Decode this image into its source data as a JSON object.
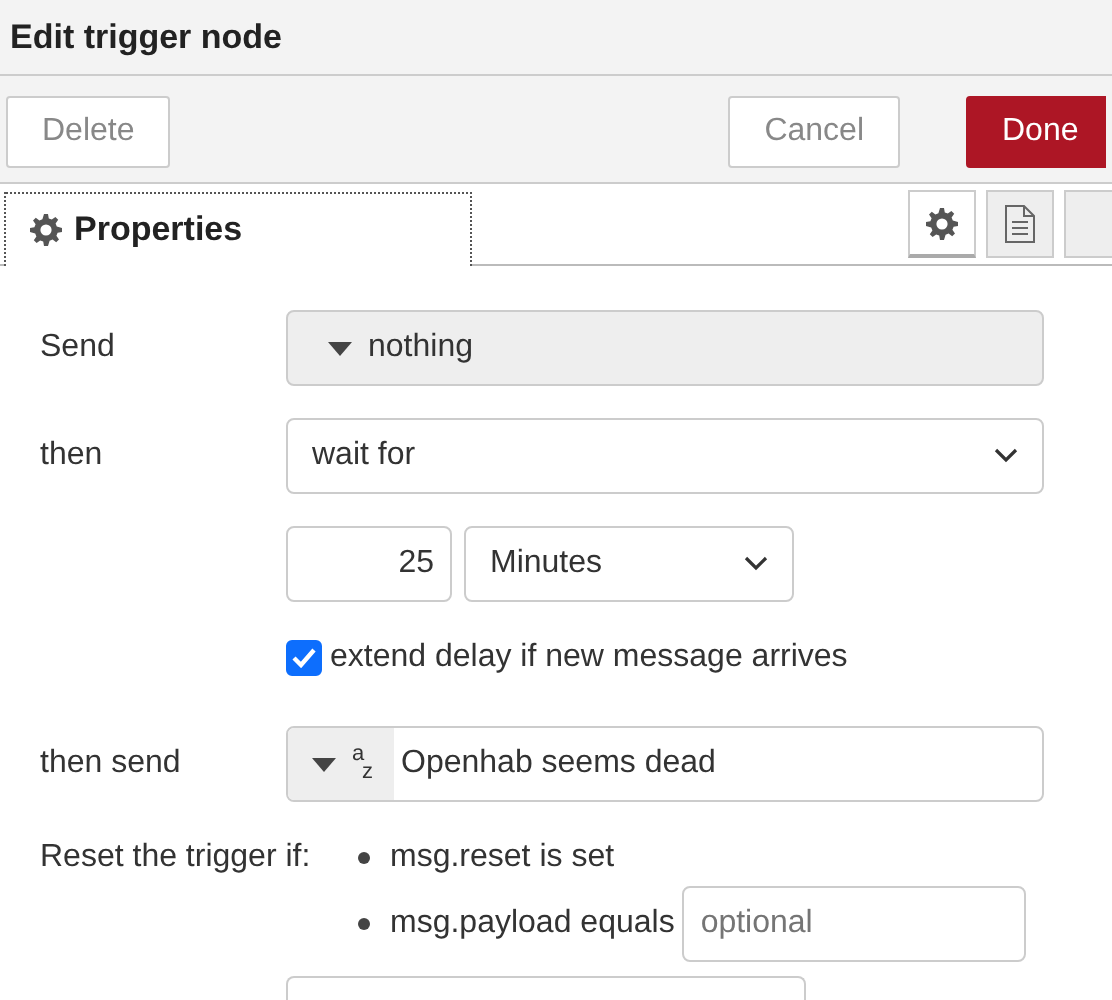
{
  "window": {
    "title": "Edit trigger node"
  },
  "buttons": [
    {
      "label": "Delete",
      "kind": "secondary"
    },
    {
      "label": "Cancel",
      "kind": "secondary"
    },
    {
      "label": "Done",
      "kind": "primary"
    }
  ],
  "tabs": [
    {
      "label": "Properties",
      "selected": true
    }
  ],
  "tab_icons": [
    {
      "kind": "gear",
      "selected": true
    },
    {
      "kind": "document",
      "selected": false
    },
    {
      "kind": "blank",
      "selected": false
    }
  ],
  "send": {
    "label": "Send",
    "value": "nothing"
  },
  "then": {
    "label": "then",
    "value": "wait for"
  },
  "duration": {
    "value": "25",
    "unit": "Minutes"
  },
  "extend": {
    "label": "extend delay if new message arrives",
    "checked": true
  },
  "then_send": {
    "label": "then send",
    "type_top": "a",
    "type_bottom": "z",
    "value": "Openhab seems dead"
  },
  "reset": {
    "label": "Reset the trigger if:",
    "conditions": [
      {
        "text": "msg.reset is set"
      },
      {
        "text": "msg.payload equals",
        "placeholder": "optional"
      }
    ]
  }
}
